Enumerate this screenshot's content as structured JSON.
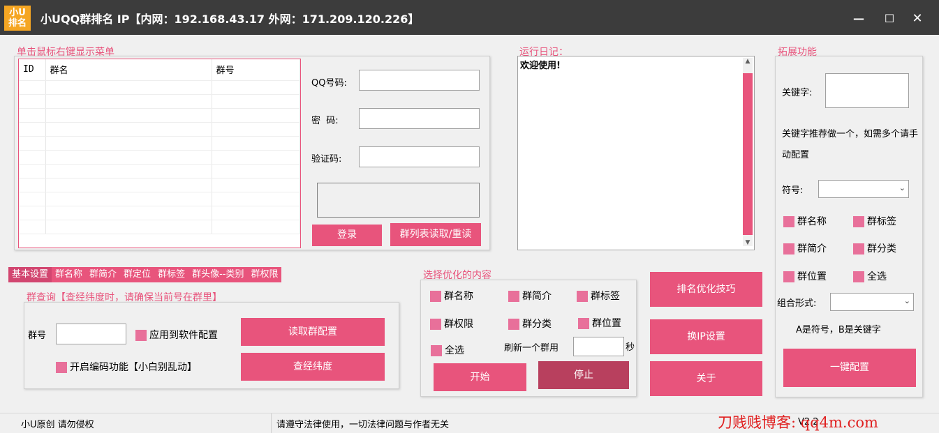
{
  "titlebar": {
    "logo_line1": "小U",
    "logo_line2": "排名",
    "title": "小UQQ群排名   IP【内网：192.168.43.17 外网：171.209.120.226】",
    "minimize": "—",
    "maximize": "☐",
    "close": "✕"
  },
  "group_list": {
    "label": "单击鼠标右键显示菜单",
    "columns": [
      "ID",
      "群名",
      "群号"
    ]
  },
  "login": {
    "qq_label": "QQ号码:",
    "pwd_label": "密  码:",
    "captcha_label": "验证码:",
    "login_button": "登录",
    "read_button": "群列表读取/重读"
  },
  "log": {
    "label": "运行日记：",
    "text": "欢迎使用!"
  },
  "extension": {
    "label": "拓展功能",
    "keyword_label": "关键字:",
    "note": "关键字推荐做一个，如需多个请手动配置",
    "symbol_label": "符号:",
    "checks": [
      "群名称",
      "群标签",
      "群简介",
      "群分类",
      "群位置",
      "全选"
    ],
    "combo_label": "组合形式:",
    "combo_note": "A是符号，B是关键字",
    "one_click_button": "一键配置"
  },
  "tabs": [
    "基本设置",
    "群名称",
    "群简介",
    "群定位",
    "群标签",
    "群头像--类别",
    "群权限"
  ],
  "query": {
    "label": "群查询【查经纬度时，请确保当前号在群里】",
    "group_no_label": "群号",
    "apply_label": "应用到软件配置",
    "encode_label": "开启编码功能【小白别乱动】",
    "read_config_button": "读取群配置",
    "geo_button": "查经纬度"
  },
  "optimize": {
    "label": "选择优化的内容",
    "checks": [
      "群名称",
      "群简介",
      "群标签",
      "群权限",
      "群分类",
      "群位置"
    ],
    "select_all": "全选",
    "refresh_label": "刷新一个群用",
    "seconds": "秒",
    "start_button": "开始",
    "stop_button": "停止"
  },
  "side_buttons": {
    "tips": "排名优化技巧",
    "ip": "换IP设置",
    "about": "关于"
  },
  "status": {
    "left": "小U原创 请勿侵权",
    "middle": "请遵守法律使用，一切法律问题与作者无关",
    "right": "V2.2"
  },
  "watermark": "刀贱贱博客: qq4m.com",
  "colors": {
    "accent": "#e8547c",
    "titlebar": "#3c3c3c"
  }
}
